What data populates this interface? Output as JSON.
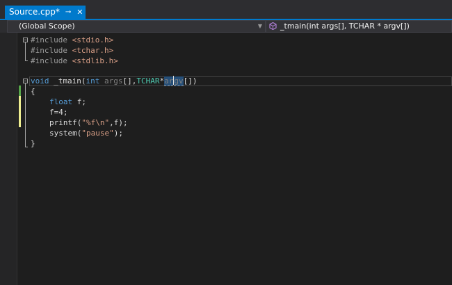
{
  "tab": {
    "title": "Source.cpp*",
    "pin_glyph": "⊸",
    "close_glyph": "✕"
  },
  "navbar": {
    "scope": "(Global Scope)",
    "function": "_tmain(int args[], TCHAR * argv[])"
  },
  "code": {
    "l1a": "#include ",
    "l1b": "<stdio.h>",
    "l2a": "#include ",
    "l2b": "<tchar.h>",
    "l3a": "#include ",
    "l3b": "<stdlib.h>",
    "l5_void": "void",
    "l5_name": " _tmain(",
    "l5_int": "int",
    "l5_args": " args",
    "l5_mid": "[],",
    "l5_tchar": "TCHAR",
    "l5_star": "*",
    "l5_sel_a": "ar",
    "l5_sel_b": "gv",
    "l5_end": "[])",
    "l6": "{",
    "l7_float": "float",
    "l7_rest": " f;",
    "l8": "f=4;",
    "l9a": "printf(",
    "l9b": "\"%f\\n\"",
    "l9c": ",f);",
    "l10a": "system(",
    "l10b": "\"pause\"",
    "l10c": ");",
    "l11": "}"
  },
  "colors": {
    "accent": "#007acc",
    "saved_change": "#57a64a",
    "unsaved_change": "#efef91"
  }
}
